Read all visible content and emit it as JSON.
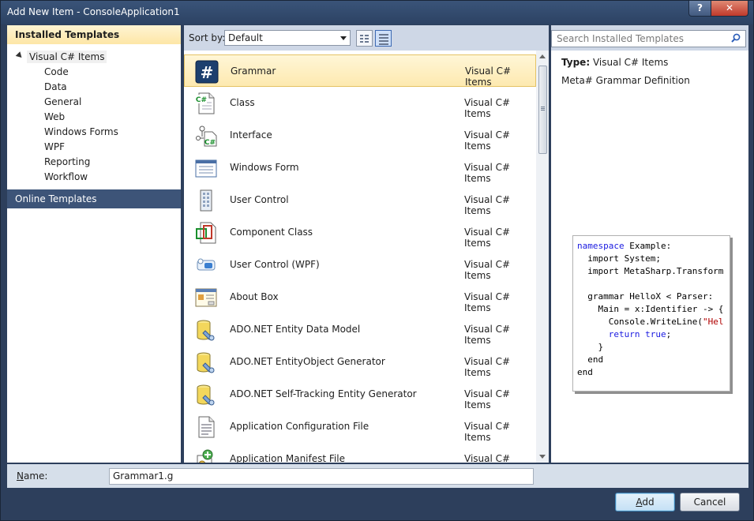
{
  "window": {
    "title": "Add New Item - ConsoleApplication1",
    "help_label": "?",
    "close_label": "✕"
  },
  "left": {
    "installed_header": "Installed Templates",
    "root_label": "Visual C# Items",
    "items": [
      "Code",
      "Data",
      "General",
      "Web",
      "Windows Forms",
      "WPF",
      "Reporting",
      "Workflow"
    ],
    "online_header": "Online Templates"
  },
  "toolbar": {
    "sort_label": "Sort by:",
    "sort_value": "Default"
  },
  "templates": [
    {
      "name": "Grammar",
      "type": "Visual C# Items",
      "icon": "grammar-icon",
      "selected": true
    },
    {
      "name": "Class",
      "type": "Visual C# Items",
      "icon": "class-icon"
    },
    {
      "name": "Interface",
      "type": "Visual C# Items",
      "icon": "interface-icon"
    },
    {
      "name": "Windows Form",
      "type": "Visual C# Items",
      "icon": "windows-form-icon"
    },
    {
      "name": "User Control",
      "type": "Visual C# Items",
      "icon": "user-control-icon"
    },
    {
      "name": "Component Class",
      "type": "Visual C# Items",
      "icon": "component-class-icon"
    },
    {
      "name": "User Control (WPF)",
      "type": "Visual C# Items",
      "icon": "wpf-user-control-icon"
    },
    {
      "name": "About Box",
      "type": "Visual C# Items",
      "icon": "about-box-icon"
    },
    {
      "name": "ADO.NET Entity Data Model",
      "type": "Visual C# Items",
      "icon": "database-icon"
    },
    {
      "name": "ADO.NET EntityObject Generator",
      "type": "Visual C# Items",
      "icon": "database-icon"
    },
    {
      "name": "ADO.NET Self-Tracking Entity Generator",
      "type": "Visual C# Items",
      "icon": "database-icon"
    },
    {
      "name": "Application Configuration File",
      "type": "Visual C# Items",
      "icon": "config-file-icon"
    },
    {
      "name": "Application Manifest File",
      "type": "Visual C# Items",
      "icon": "manifest-file-icon"
    }
  ],
  "details": {
    "search_placeholder": "Search Installed Templates",
    "type_label": "Type:",
    "type_value": "Visual C# Items",
    "description": "Meta# Grammar Definition"
  },
  "code_preview": [
    [
      {
        "t": "namespace",
        "c": "kw"
      },
      {
        "t": " Example:"
      }
    ],
    [
      {
        "t": "  import System;"
      }
    ],
    [
      {
        "t": "  import MetaSharp.Transform"
      }
    ],
    [
      {
        "t": ""
      }
    ],
    [
      {
        "t": "  grammar HelloX < Parser:"
      }
    ],
    [
      {
        "t": "    Main = x:Identifier -> {"
      }
    ],
    [
      {
        "t": "      Console.WriteLine("
      },
      {
        "t": "\"Hel",
        "c": "str"
      }
    ],
    [
      {
        "t": "      "
      },
      {
        "t": "return",
        "c": "kw"
      },
      {
        "t": " "
      },
      {
        "t": "true",
        "c": "kw"
      },
      {
        "t": ";"
      }
    ],
    [
      {
        "t": "    }"
      }
    ],
    [
      {
        "t": "  end"
      }
    ],
    [
      {
        "t": "end"
      }
    ]
  ],
  "name_field": {
    "label_prefix": "",
    "label_accel": "N",
    "label_rest": "ame:",
    "value": "Grammar1.g"
  },
  "buttons": {
    "add_accel": "A",
    "add_rest": "dd",
    "cancel": "Cancel"
  }
}
